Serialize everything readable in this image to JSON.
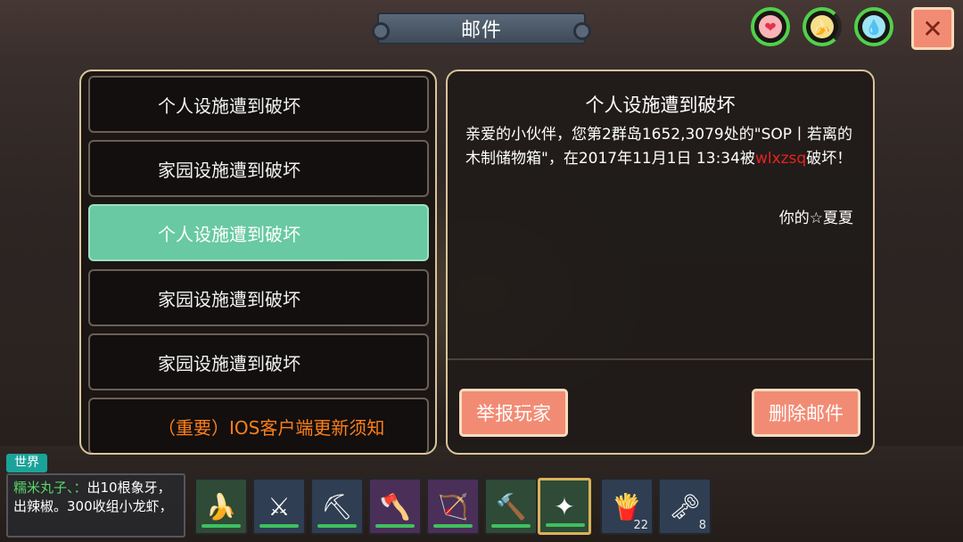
{
  "header": {
    "title": "邮件",
    "close_label": "✕"
  },
  "status_icons": [
    {
      "name": "heart-icon",
      "glyph": "❤"
    },
    {
      "name": "hunger-icon",
      "glyph": "🍌"
    },
    {
      "name": "water-icon",
      "glyph": "💧"
    }
  ],
  "mail_list": [
    {
      "label": "个人设施遭到破坏",
      "selected": false
    },
    {
      "label": "家园设施遭到破坏",
      "selected": false
    },
    {
      "label": "个人设施遭到破坏",
      "selected": true
    },
    {
      "label": "家园设施遭到破坏",
      "selected": false
    },
    {
      "label": "家园设施遭到破坏",
      "selected": false
    },
    {
      "label": "（重要）IOS客户端更新须知",
      "selected": false,
      "important": true
    }
  ],
  "mail_detail": {
    "title": "个人设施遭到破坏",
    "body_part1": "亲爱的小伙伴，您第2群岛1652,3079处的\"SOP丨若离的木制储物箱\"，在2017年11月1日 13:34被",
    "body_attacker": "wlxzsq",
    "body_part2": "破坏！",
    "signature": "你的☆夏夏"
  },
  "actions": {
    "report_label": "举报玩家",
    "delete_label": "删除邮件"
  },
  "chat": {
    "channel": "世界",
    "sender": "糯米丸子、：",
    "message": "出10根象牙，出辣椒。300收组小龙虾，"
  },
  "hotbar": [
    {
      "name": "banana-bag-item-icon",
      "glyph": "🍌",
      "count": ""
    },
    {
      "name": "scythe-item-icon",
      "glyph": "⚔",
      "count": ""
    },
    {
      "name": "pickaxe-item-icon",
      "glyph": "⛏",
      "count": ""
    },
    {
      "name": "axe-item-icon",
      "glyph": "🪓",
      "count": ""
    },
    {
      "name": "bow-item-icon",
      "glyph": "🏹",
      "count": ""
    },
    {
      "name": "club-item-icon",
      "glyph": "🔨",
      "count": ""
    },
    {
      "name": "magic-staff-item-icon",
      "glyph": "✦",
      "count": ""
    },
    {
      "name": "fries-item-icon",
      "glyph": "🍟",
      "count": "22"
    },
    {
      "name": "keys-item-icon",
      "glyph": "🗝",
      "count": "8"
    }
  ]
}
